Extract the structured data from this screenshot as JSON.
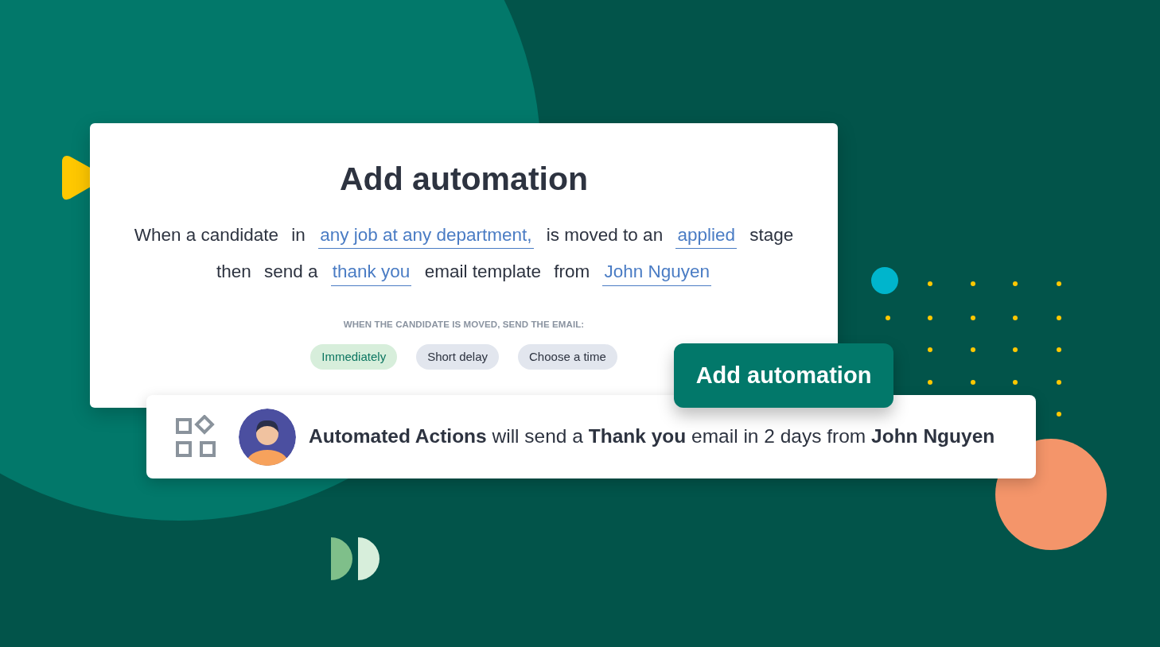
{
  "card": {
    "title": "Add automation",
    "sentence_lines": [
      [
        {
          "kind": "plain",
          "text": "When a candidate"
        },
        {
          "kind": "plain",
          "text": "in"
        },
        {
          "kind": "link",
          "text": "any job at any department,"
        },
        {
          "kind": "plain",
          "text": "is moved to an"
        },
        {
          "kind": "link",
          "text": "applied"
        },
        {
          "kind": "plain",
          "text": "stage"
        }
      ],
      [
        {
          "kind": "plain",
          "text": "then"
        },
        {
          "kind": "plain",
          "text": "send a"
        },
        {
          "kind": "link",
          "text": "thank you"
        },
        {
          "kind": "plain",
          "text": "email template"
        },
        {
          "kind": "plain",
          "text": "from"
        },
        {
          "kind": "link",
          "text": "John Nguyen"
        }
      ]
    ],
    "timing_label": "WHEN THE CANDIDATE IS MOVED, SEND THE EMAIL:",
    "timing_options": [
      {
        "label": "Immediately",
        "selected": true
      },
      {
        "label": "Short delay",
        "selected": false
      },
      {
        "label": "Choose a time",
        "selected": false
      }
    ]
  },
  "action_button": "Add automation",
  "notification": {
    "message": "**Automated Actions** will send a **Thank you** email in 2 days from **John Nguyen**"
  }
}
